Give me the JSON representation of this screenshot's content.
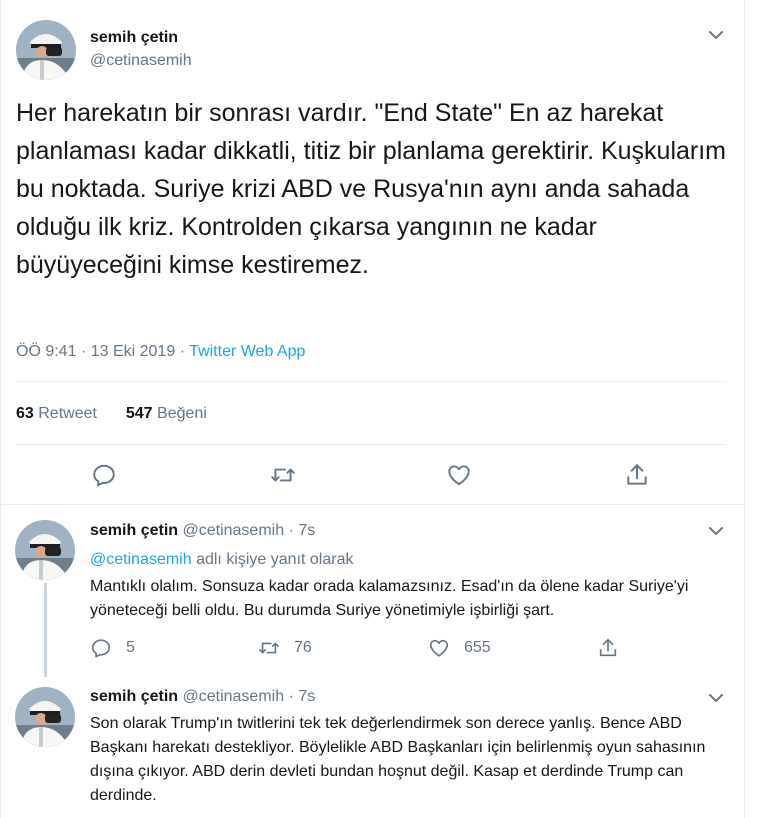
{
  "main_tweet": {
    "author_name": "semih çetin",
    "author_handle": "@cetinasemih",
    "text": "Her harekatın bir sonrası vardır. \"End State\" En az harekat planlaması kadar dikkatli, titiz bir planlama gerektirir. Kuşkularım bu noktada. Suriye krizi ABD ve Rusya'nın aynı anda sahada olduğu ilk kriz. Kontrolden çıkarsa yangının ne kadar büyüyeceğini kimse kestiremez.",
    "time": "ÖÖ 9:41",
    "date": "13 Eki 2019",
    "separator": "·",
    "source": "Twitter Web App",
    "retweet_count": "63",
    "retweet_label": "Retweet",
    "like_count": "547",
    "like_label": "Beğeni",
    "actions": [
      "reply-icon",
      "retweet-icon",
      "like-icon",
      "share-icon"
    ]
  },
  "replies": [
    {
      "author_name": "semih çetin",
      "author_handle": "@cetinasemih",
      "separator": "·",
      "age": "7s",
      "replying_to_handle": "@cetinasemih",
      "replying_suffix": "adlı kişiye yanıt olarak",
      "text": "Mantıklı olalım. Sonsuza kadar orada kalamazsınız. Esad'ın  da ölene kadar Suriye'yi yöneteceği belli oldu. Bu durumda Suriye yönetimiyle işbirliği şart.",
      "reply_count": "5",
      "retweet_count": "76",
      "like_count": "655"
    },
    {
      "author_name": "semih çetin",
      "author_handle": "@cetinasemih",
      "separator": "·",
      "age": "7s",
      "text": "Son olarak Trump'ın twitlerini tek tek değerlendirmek son derece yanlış. Bence ABD Başkanı harekatı destekliyor. Böylelikle ABD Başkanları için belirlenmiş oyun sahasının dışına çıkıyor. ABD derin devleti bundan hoşnut değil. Kasap et derdinde Trump can derdinde."
    }
  ],
  "colors": {
    "text": "#14171a",
    "secondary": "#657786",
    "accent": "#1da1f2",
    "border": "#e6ecf0"
  }
}
